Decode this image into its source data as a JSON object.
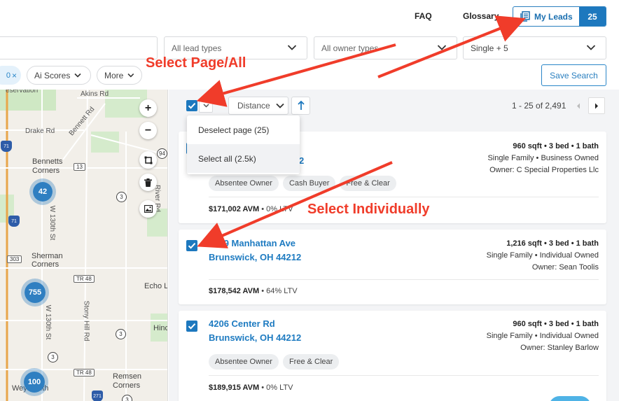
{
  "header": {
    "faq": "FAQ",
    "glossary": "Glossary",
    "my_leads_label": "My Leads",
    "my_leads_count": "25"
  },
  "filters": {
    "lead_types": "All lead types",
    "owner_types": "All owner types",
    "property_types": "Single + 5",
    "chip_partial": "0",
    "ai_scores": "Ai Scores",
    "more": "More",
    "save_search": "Save Search"
  },
  "map": {
    "labels": {
      "reservation": "eservation",
      "akins": "Akins Rd",
      "drake": "Drake Rd",
      "bennett": "Bennett Rd",
      "bennetts_corners_1": "Bennetts",
      "bennetts_corners_2": "Corners",
      "w130": "W 130th St",
      "river": "River Rd",
      "sherman_1": "Sherman",
      "sherman_2": "Corners",
      "echo": "Echo L",
      "stony": "Stony Hill Rd",
      "w130b": "W 130th St",
      "hinc": "Hinc",
      "remsen_1": "Remsen",
      "remsen_2": "Corners",
      "weymouth": "Weymouth"
    },
    "shields": {
      "i71a": "71",
      "r13": "13",
      "r94": "94",
      "r3a": "3",
      "i71b": "71",
      "r303": "303",
      "tr48a": "TR 48",
      "r3b": "3",
      "r3c": "3",
      "tr48b": "TR 48",
      "r3d": "3",
      "i271": "271"
    },
    "clusters": {
      "c42": "42",
      "c755": "755",
      "c100": "100"
    },
    "zoom_in": "+",
    "zoom_out": "−"
  },
  "list": {
    "sort_label": "Distance",
    "pager": "1 - 25 of 2,491",
    "dropdown": {
      "deselect_page": "Deselect page (25)",
      "select_all": "Select all (2.5k)"
    },
    "cards": [
      {
        "address_line1": "",
        "address_line2": "2",
        "specs": "960 sqft • 3 bed • 1 bath",
        "type": "Single Family • Business Owned",
        "owner": "Owner: C Special Properties Llc",
        "tags": [
          "Absentee Owner",
          "Cash Buyer",
          "Free & Clear"
        ],
        "avm": "$171,002 AVM",
        "ltv": " • 0% LTV"
      },
      {
        "address_line1": "4239 Manhattan Ave",
        "address_line2": "Brunswick, OH 44212",
        "specs": "1,216 sqft • 3 bed • 1 bath",
        "type": "Single Family • Individual Owned",
        "owner": "Owner: Sean Toolis",
        "avm": "$178,542 AVM",
        "ltv": " • 64% LTV"
      },
      {
        "address_line1": "4206 Center Rd",
        "address_line2": "Brunswick, OH 44212",
        "specs": "960 sqft • 3 bed • 1 bath",
        "type": "Single Family • Individual Owned",
        "owner": "Owner: Stanley Barlow",
        "tags": [
          "Absentee Owner",
          "Free & Clear"
        ],
        "avm": "$189,915 AVM",
        "ltv": " • 0% LTV"
      }
    ]
  },
  "annotations": {
    "select_page_all": "Select Page/All",
    "select_individually": "Select Individually",
    "color": "#f03c2a"
  },
  "colors": {
    "accent": "#1d78be",
    "link": "#1e7bc1"
  }
}
